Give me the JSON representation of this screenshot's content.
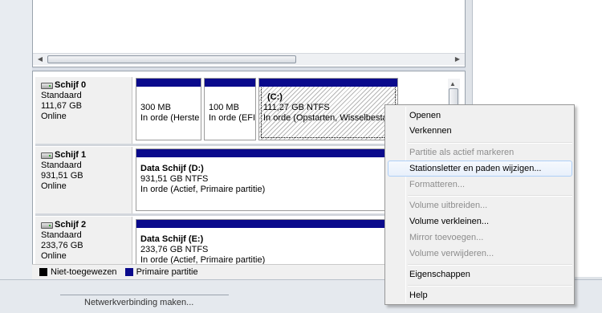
{
  "disks": [
    {
      "name": "Schijf 0",
      "type": "Standaard",
      "size": "111,67 GB",
      "status": "Online",
      "partitions": [
        {
          "title": "",
          "size": "300 MB",
          "status": "In orde (Herste"
        },
        {
          "title": "",
          "size": "100 MB",
          "status": "In orde (EFI-"
        },
        {
          "title": "(C:)",
          "size": "111,27 GB NTFS",
          "status": "In orde (Opstarten, Wisselbestan"
        }
      ]
    },
    {
      "name": "Schijf 1",
      "type": "Standaard",
      "size": "931,51 GB",
      "status": "Online",
      "partitions": [
        {
          "title": "Data Schijf  (D:)",
          "size": "931,51 GB NTFS",
          "status": "In orde (Actief, Primaire partitie)"
        }
      ]
    },
    {
      "name": "Schijf 2",
      "type": "Standaard",
      "size": "233,76 GB",
      "status": "Online",
      "partitions": [
        {
          "title": "Data Schijf  (E:)",
          "size": "233,76 GB NTFS",
          "status": "In orde (Actief, Primaire partitie)"
        }
      ]
    }
  ],
  "legend": {
    "unallocated": {
      "label": "Niet-toegewezen",
      "color": "#000000"
    },
    "primary": {
      "label": "Primaire partitie",
      "color": "#0a0a8c"
    }
  },
  "context_menu": {
    "items": [
      {
        "label": "Openen",
        "enabled": true
      },
      {
        "label": "Verkennen",
        "enabled": true
      },
      {
        "label": "Partitie als actief markeren",
        "enabled": false
      },
      {
        "label": "Stationsletter en paden wijzigen...",
        "enabled": true,
        "highlighted": true
      },
      {
        "label": "Formatteren...",
        "enabled": false
      },
      {
        "label": "Volume uitbreiden...",
        "enabled": false
      },
      {
        "label": "Volume verkleinen...",
        "enabled": true
      },
      {
        "label": "Mirror toevoegen...",
        "enabled": false
      },
      {
        "label": "Volume verwijderen...",
        "enabled": false
      },
      {
        "label": "Eigenschappen",
        "enabled": true
      },
      {
        "label": "Help",
        "enabled": true
      }
    ]
  },
  "bottom_text": "Netwerkverbinding maken...",
  "icons": {
    "disk": "hard-disk-icon",
    "scroll_left": "scroll-left-arrow-icon",
    "scroll_right": "scroll-right-arrow-icon",
    "scroll_up": "scroll-up-arrow-icon"
  }
}
